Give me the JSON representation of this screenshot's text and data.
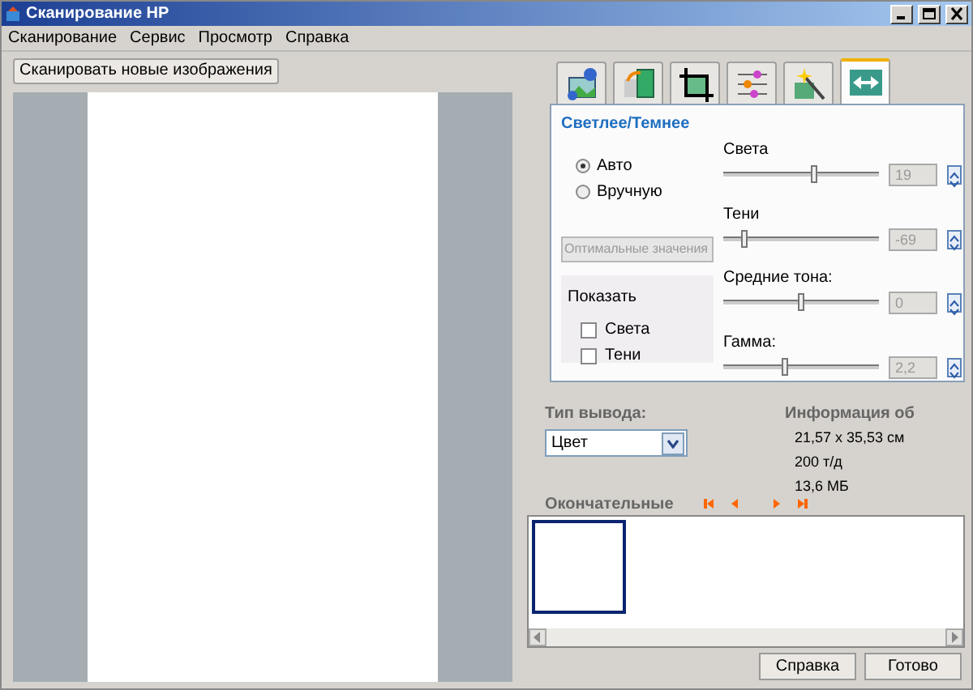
{
  "window": {
    "title": "Сканирование HP"
  },
  "menu": [
    "Сканирование",
    "Сервис",
    "Просмотр",
    "Справка"
  ],
  "toolbar": {
    "scan_button": "Сканировать новые изображения"
  },
  "tabs": [
    {
      "kind": "scan",
      "selected": false
    },
    {
      "kind": "export",
      "selected": false
    },
    {
      "kind": "crop",
      "selected": false
    },
    {
      "kind": "sliders",
      "selected": false
    },
    {
      "kind": "magic",
      "selected": false
    },
    {
      "kind": "arrows",
      "selected": true
    }
  ],
  "panel": {
    "title": "Светлее/Темнее",
    "radios": [
      {
        "label": "Авто",
        "selected": true
      },
      {
        "label": "Вручную",
        "selected": false
      }
    ],
    "optimal_button": {
      "label": "Оптимальные значения",
      "disabled": true
    },
    "show": {
      "label": "Показать",
      "checkboxes": [
        {
          "label": "Света",
          "checked": false
        },
        {
          "label": "Тени",
          "checked": false
        }
      ]
    },
    "sliders": [
      {
        "label": "Света",
        "level": 0.58,
        "value": "19",
        "disabled": true
      },
      {
        "label": "Тени",
        "level": 0.14,
        "value": "-69",
        "disabled": true
      },
      {
        "label": "Средние тона:",
        "level": 0.5,
        "value": "0",
        "disabled": true
      },
      {
        "label": "Гамма:",
        "level": 0.4,
        "value": "2,2",
        "disabled": true
      }
    ]
  },
  "output": {
    "label": "Тип вывода:",
    "value": "Цвет"
  },
  "info": {
    "title": "Информация об",
    "lines": [
      "21,57 x 35,53 см",
      "200 т/д",
      "13,6 МБ"
    ]
  },
  "finals": {
    "label": "Окончательные",
    "thumbnails": [
      {
        "selected": true
      }
    ]
  },
  "buttons": [
    "Справка",
    "Готово"
  ]
}
